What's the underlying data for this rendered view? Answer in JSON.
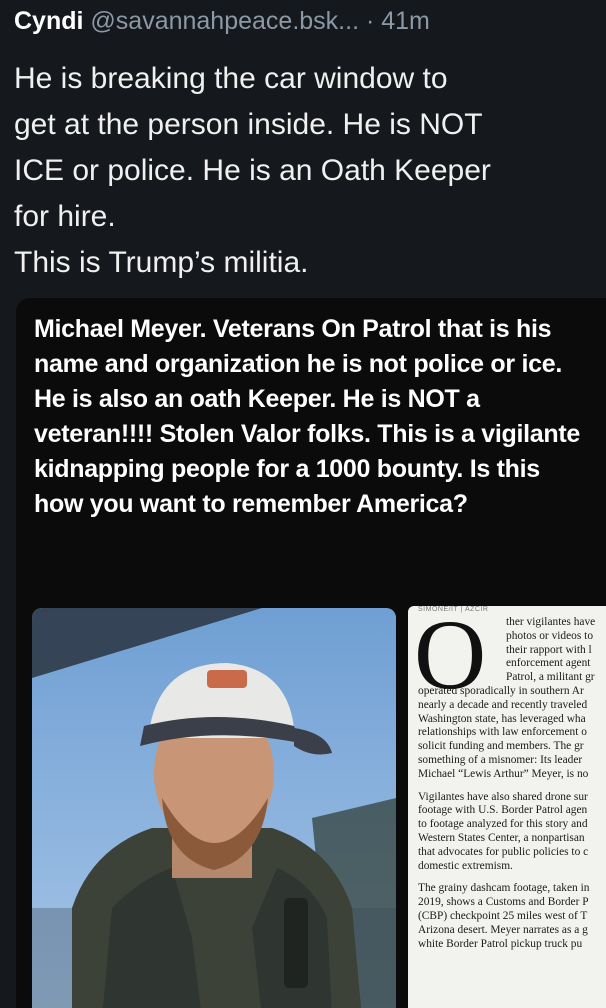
{
  "post": {
    "author_name": "Cyndi",
    "author_handle": "@savannahpeace.bsk...",
    "separator": "·",
    "timestamp": "41m",
    "text_lines": [
      "He is breaking the car window to",
      "get at the person inside. He is NOT",
      "ICE or police. He is an Oath Keeper",
      "for hire.",
      "This is Trump’s militia."
    ]
  },
  "embed": {
    "caption": "Michael Meyer. Veterans On Patrol that is his name and organization he is not police or ice. He is also an oath Keeper. He is NOT a veteran!!!! Stolen Valor folks. This is a vigilante kidnapping people for a 1000 bounty. Is this how you want to remember America?",
    "article": {
      "kicker": "SIMONE/IT | AZCIR",
      "dropcap": "O",
      "paragraphs": [
        {
          "lines": [
            "ther vigilantes have",
            "photos or videos to",
            "their rapport with l",
            "enforcement agent",
            "Patrol, a militant gr",
            "operated sporadically in southern Ar",
            "nearly a decade and recently traveled",
            "Washington state, has leveraged wha",
            "relationships with law enforcement o",
            "solicit funding and members. The gr",
            "something of a misnomer: Its leader",
            "Michael “Lewis Arthur” Meyer, is no"
          ]
        },
        {
          "lines": [
            "Vigilantes have also shared drone sur",
            "footage with U.S. Border Patrol agen",
            "to footage analyzed for this story and",
            "Western States Center, a nonpartisan",
            "that advocates for public policies to c",
            "domestic extremism."
          ]
        },
        {
          "lines": [
            "The grainy dashcam footage, taken in",
            "2019, shows a Customs and Border P",
            "(CBP) checkpoint 25 miles west of T",
            "Arizona desert. Meyer narrates as a g",
            "white Border Patrol pickup truck pu"
          ]
        }
      ]
    }
  }
}
